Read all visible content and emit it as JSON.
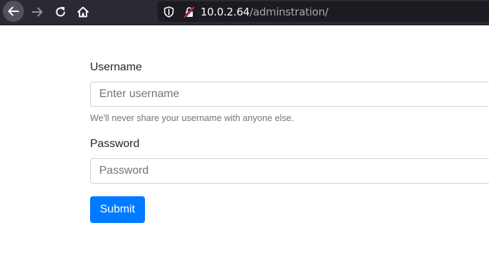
{
  "browser": {
    "url_host": "10.0.2.64",
    "url_path": "/adminstration/",
    "icons": {
      "back": "arrow-left-icon",
      "forward": "arrow-right-icon",
      "reload": "reload-icon",
      "home": "home-icon",
      "tracking": "shield-icon",
      "security": "insecure-lock-icon"
    },
    "colors": {
      "toolbar": "#2b2a33",
      "urlbar": "#1c1b22",
      "insecure_slash": "#e22850"
    }
  },
  "form": {
    "username_label": "Username",
    "username_placeholder": "Enter username",
    "username_help": "We'll never share your username with anyone else.",
    "password_label": "Password",
    "password_placeholder": "Password",
    "submit_label": "Submit",
    "colors": {
      "primary": "#007bff",
      "text": "#212529",
      "muted": "#6c757d",
      "border": "#ced4da"
    }
  }
}
